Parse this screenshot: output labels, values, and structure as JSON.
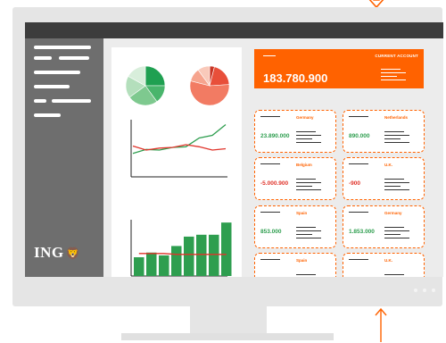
{
  "brand": {
    "logo_text": "ING",
    "accent": "#ff6200",
    "green": "#2e9e4f",
    "red": "#e0332a"
  },
  "current_account": {
    "label": "CURRENT ACCOUNT",
    "value": "183.780.900"
  },
  "cards": [
    {
      "country": "Germany",
      "amount": "23.890.000",
      "amount_color": "#2e9e4f"
    },
    {
      "country": "Netherlands",
      "amount": "890.000",
      "amount_color": "#2e9e4f"
    },
    {
      "country": "Belgium",
      "amount": "-5.000.900",
      "amount_color": "#e0332a"
    },
    {
      "country": "U.K.",
      "amount": "-900",
      "amount_color": "#e0332a"
    },
    {
      "country": "Spain",
      "amount": "853.000",
      "amount_color": "#2e9e4f"
    },
    {
      "country": "Germany",
      "amount": "1.853.000",
      "amount_color": "#2e9e4f"
    },
    {
      "country": "Spain",
      "amount": "",
      "amount_color": "#2e9e4f"
    },
    {
      "country": "U.K.",
      "amount": "",
      "amount_color": "#2e9e4f"
    }
  ],
  "chart_data": [
    {
      "type": "pie",
      "values": [
        25,
        15,
        25,
        18,
        17
      ],
      "colors": [
        "#1fa051",
        "#49b56c",
        "#7ec98f",
        "#b4dfbc",
        "#d8eedb"
      ]
    },
    {
      "type": "pie",
      "values": [
        4,
        20,
        55,
        11,
        10
      ],
      "colors": [
        "#c73425",
        "#e84f3a",
        "#f27b63",
        "#f6a48e",
        "#f9c9ba"
      ]
    },
    {
      "type": "line",
      "series": [
        {
          "color": "#2e9e4f",
          "values": [
            3.5,
            4.1,
            4.0,
            4.4,
            4.5,
            5.8,
            6.2,
            7.8
          ]
        },
        {
          "color": "#e0332a",
          "values": [
            4.6,
            4.0,
            4.3,
            4.4,
            4.8,
            4.5,
            4.0,
            4.2
          ]
        }
      ]
    },
    {
      "type": "bar",
      "values": [
        2.0,
        2.5,
        2.2,
        3.2,
        4.2,
        4.4,
        4.4,
        5.7
      ],
      "line": {
        "color": "#e0332a",
        "values": [
          2.4,
          2.4,
          2.4,
          2.3,
          2.3,
          2.3,
          2.3,
          2.3
        ]
      }
    }
  ]
}
